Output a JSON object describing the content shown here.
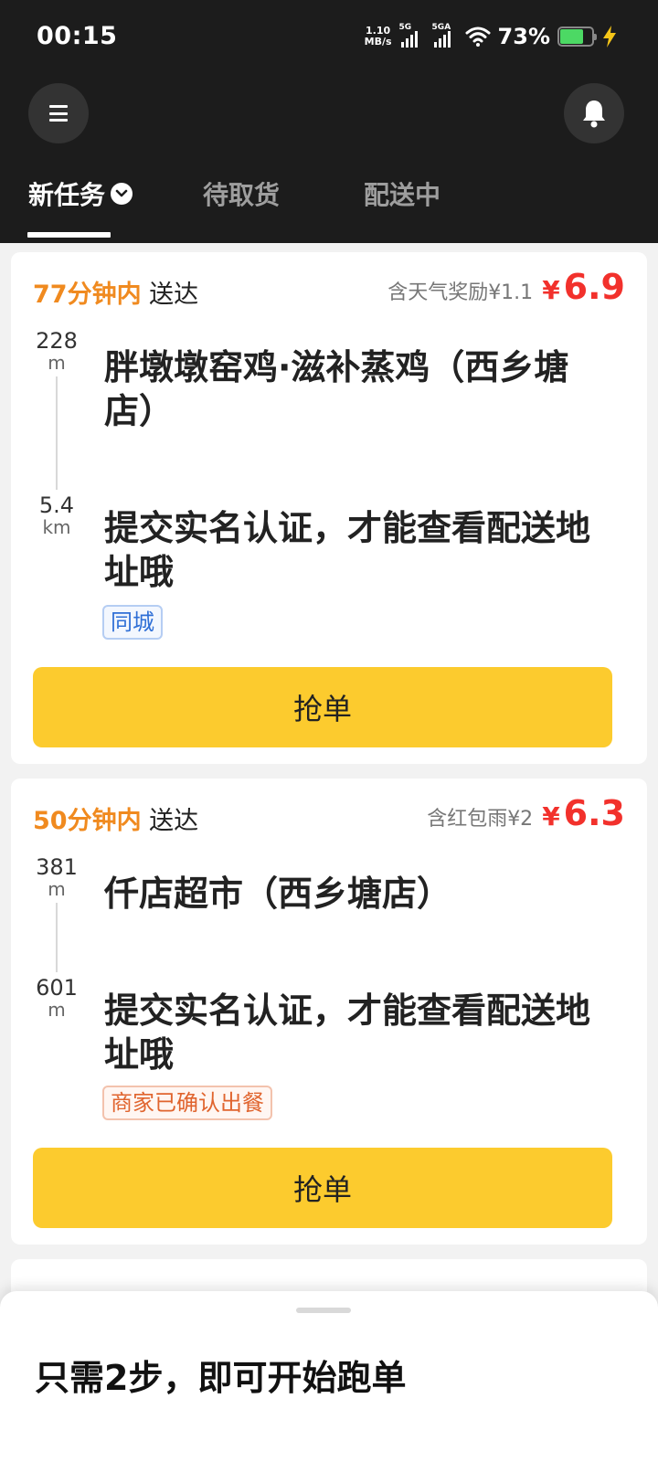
{
  "status_bar": {
    "time": "00:15",
    "net_speed_value": "1.10",
    "net_speed_unit": "MB/s",
    "sim1_label": "5G",
    "sim2_label": "5GA",
    "battery_percent": "73%",
    "battery_level": 0.73,
    "battery_color": "#4cd964"
  },
  "header": {
    "menu_icon": "hamburger-menu-icon",
    "bell_icon": "bell-icon",
    "tabs": [
      {
        "label": "新任务",
        "active": true
      },
      {
        "label": "待取货",
        "active": false
      },
      {
        "label": "配送中",
        "active": false
      }
    ]
  },
  "orders": [
    {
      "time_limit": "77分钟内",
      "deliver_label": "送达",
      "bonus": "含天气奖励¥1.1",
      "currency": "¥",
      "price": "6.9",
      "pickup_distance": "228",
      "pickup_unit": "m",
      "pickup_name": "胖墩墩窑鸡·滋补蒸鸡（西乡塘店）",
      "delivery_distance": "5.4",
      "delivery_unit": "km",
      "delivery_address": "提交实名认证，才能查看配送地址哦",
      "tag": "同城",
      "button": "抢单"
    },
    {
      "time_limit": "50分钟内",
      "deliver_label": "送达",
      "bonus": "含红包雨¥2",
      "currency": "¥",
      "price": "6.3",
      "pickup_distance": "381",
      "pickup_unit": "m",
      "pickup_name": "仟店超市（西乡塘店）",
      "delivery_distance": "601",
      "delivery_unit": "m",
      "delivery_address": "提交实名认证，才能查看配送地址哦",
      "tag": "商家已确认出餐",
      "button": "抢单"
    }
  ],
  "bottom_sheet": {
    "title": "只需2步，即可开始跑单"
  },
  "colors": {
    "accent_yellow": "#fccb2e",
    "price_red": "#f2312c",
    "time_orange": "#f08a1f",
    "header_bg": "#1c1c1c"
  }
}
